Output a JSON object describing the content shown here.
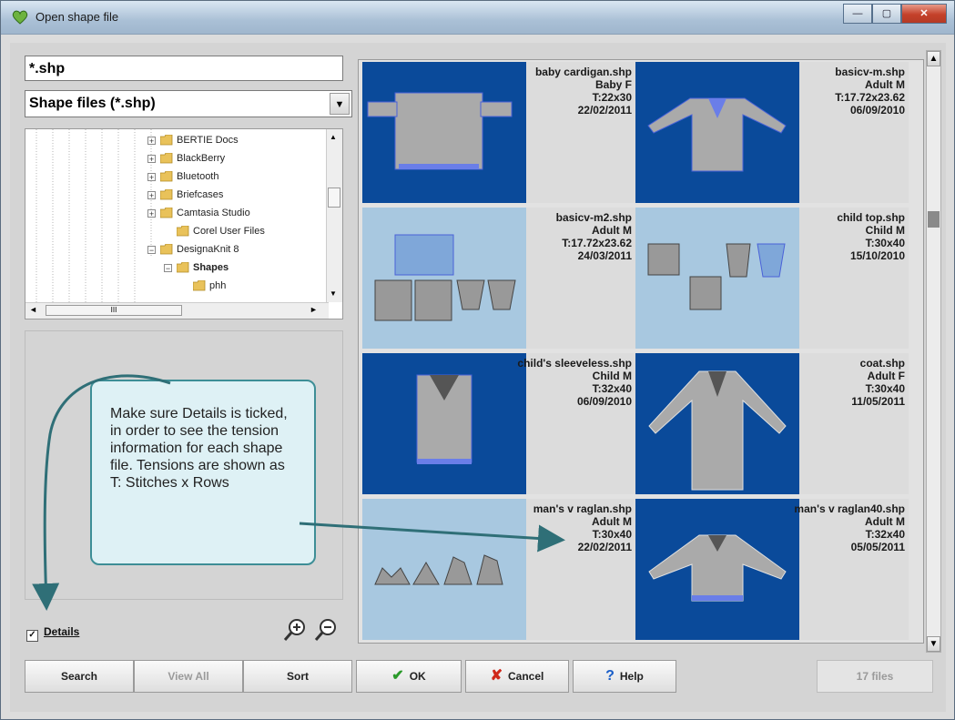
{
  "window": {
    "title": "Open shape file",
    "controls": [
      "minimize-icon",
      "maximize-icon",
      "close-icon"
    ]
  },
  "filter": {
    "pattern": "*.shp",
    "type_selected": "Shape files (*.shp)"
  },
  "tree": {
    "items": [
      {
        "label": "BERTIE Docs",
        "expander": "+"
      },
      {
        "label": "BlackBerry",
        "expander": "+"
      },
      {
        "label": "Bluetooth",
        "expander": "+"
      },
      {
        "label": "Briefcases",
        "expander": "+"
      },
      {
        "label": "Camtasia Studio",
        "expander": "+"
      },
      {
        "label": "Corel User Files",
        "expander": ""
      },
      {
        "label": "DesignaKnit 8",
        "expander": "−"
      },
      {
        "label": "Shapes",
        "expander": "−"
      },
      {
        "label": "phh",
        "expander": ""
      }
    ],
    "hscroll_marker": "III"
  },
  "files": [
    {
      "name": "baby cardigan.shp",
      "size": "Baby F",
      "tension": "T:22x30",
      "date": "22/02/2011",
      "bg": "dark"
    },
    {
      "name": "basicv-m.shp",
      "size": "Adult M",
      "tension": "T:17.72x23.62",
      "date": "06/09/2010",
      "bg": "dark"
    },
    {
      "name": "basicv-m2.shp",
      "size": "Adult M",
      "tension": "T:17.72x23.62",
      "date": "24/03/2011",
      "bg": "light"
    },
    {
      "name": "child top.shp",
      "size": "Child M",
      "tension": "T:30x40",
      "date": "15/10/2010",
      "bg": "light"
    },
    {
      "name": "child's sleeveless.shp",
      "size": "Child M",
      "tension": "T:32x40",
      "date": "06/09/2010",
      "bg": "dark"
    },
    {
      "name": "coat.shp",
      "size": "Adult F",
      "tension": "T:30x40",
      "date": "11/05/2011",
      "bg": "dark"
    },
    {
      "name": "man's v raglan.shp",
      "size": "Adult M",
      "tension": "T:30x40",
      "date": "22/02/2011",
      "bg": "light"
    },
    {
      "name": "man's v raglan40.shp",
      "size": "Adult M",
      "tension": "T:32x40",
      "date": "05/05/2011",
      "bg": "dark"
    }
  ],
  "callout": {
    "text": "Make sure Details is ticked, in order to see the tension information for each shape file. Tensions are shown as T: Stitches x Rows"
  },
  "details": {
    "label": "Details",
    "checked": true
  },
  "buttons": {
    "search": "Search",
    "view_all": "View All",
    "sort": "Sort",
    "ok": "OK",
    "cancel": "Cancel",
    "help": "Help",
    "file_count": "17 files"
  }
}
